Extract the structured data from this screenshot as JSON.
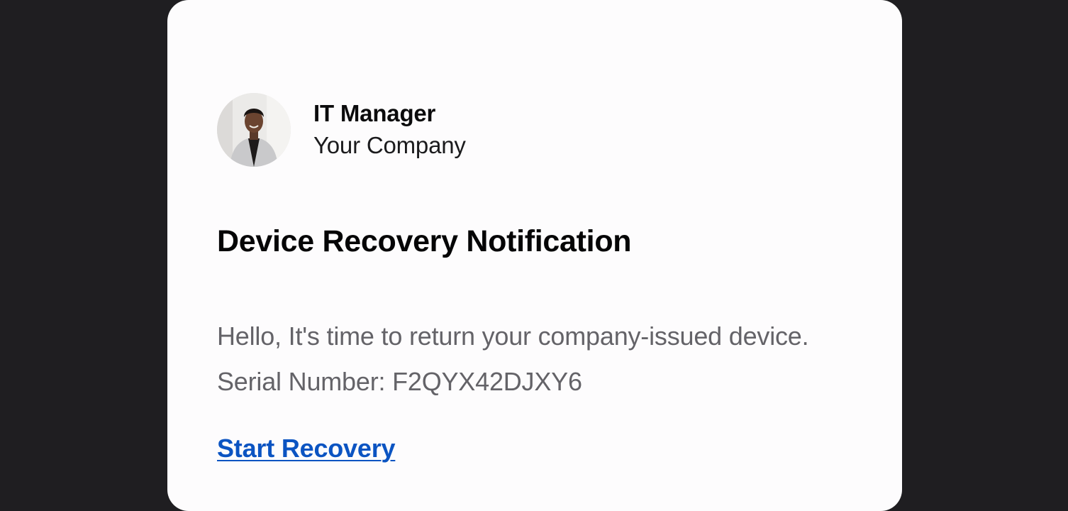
{
  "sender": {
    "name": "IT Manager",
    "organization": "Your Company",
    "avatar_icon": "person-avatar-icon"
  },
  "message": {
    "title": "Device Recovery Notification",
    "body": "Hello, It's time to return your company-issued device. Serial Number: F2QYX42DJXY6",
    "cta_label": "Start Recovery"
  },
  "colors": {
    "page_background": "#1f1e21",
    "card_background": "#fdfcfd",
    "link": "#0b54c2",
    "body_text": "#646368"
  }
}
